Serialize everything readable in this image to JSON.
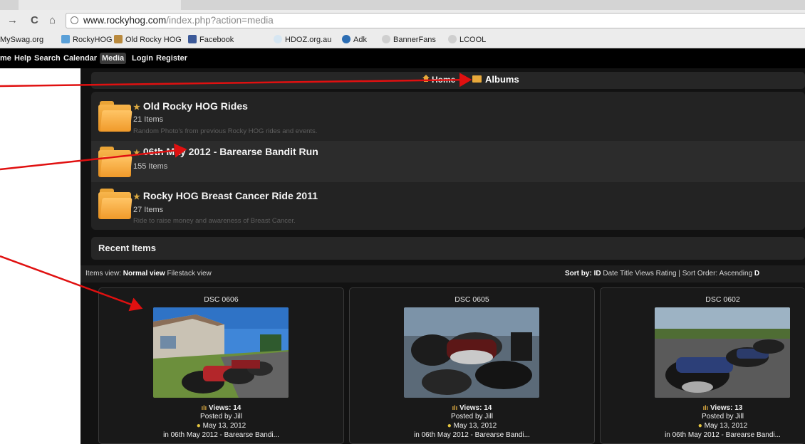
{
  "browser": {
    "url_host": "www.rockyhog.com",
    "url_path": "/index.php?action=media",
    "bookmarks": [
      "MySwag.org",
      "RockyHOG",
      "Old Rocky HOG",
      "Facebook",
      "HDOZ.org.au",
      "Adk",
      "BannerFans",
      "LCOOL"
    ]
  },
  "nav": {
    "items": [
      "me",
      "Help",
      "Search",
      "Calendar",
      "Media",
      "Login",
      "Register"
    ],
    "active": "Media"
  },
  "breadcrumb": {
    "home": "Home",
    "albums": "Albums"
  },
  "albums": [
    {
      "title": "Old Rocky HOG Rides",
      "count": "21 Items",
      "description": "Random Photo's from previous Rocky HOG rides and events."
    },
    {
      "title": "06th May 2012 - Barearse Bandit Run",
      "count": "155 Items",
      "description": ""
    },
    {
      "title": "Rocky HOG Breast Cancer Ride 2011",
      "count": "27 Items",
      "description": "Ride to raise money and awareness of Breast Cancer."
    }
  ],
  "recent": {
    "title": "Recent Items",
    "items_view_label": "Items view:",
    "items_view_options": [
      "Normal view",
      "Filestack view"
    ],
    "sort_by_label": "Sort by:",
    "sort_options": [
      "ID",
      "Date",
      "Title",
      "Views",
      "Rating"
    ],
    "sort_order_label": "| Sort Order:",
    "sort_order_value": "Ascending",
    "sort_order_trail": "D"
  },
  "items": [
    {
      "title": "DSC 0606",
      "views": "Views: 14",
      "posted_by": "Posted by Jill",
      "date": "May 13, 2012",
      "album": "in 06th May 2012 - Barearse Bandi..."
    },
    {
      "title": "DSC 0605",
      "views": "Views: 14",
      "posted_by": "Posted by Jill",
      "date": "May 13, 2012",
      "album": "in 06th May 2012 - Barearse Bandi..."
    },
    {
      "title": "DSC 0602",
      "views": "Views: 13",
      "posted_by": "Posted by Jill",
      "date": "May 13, 2012",
      "album": "in 06th May 2012 - Barearse Bandi..."
    }
  ],
  "colors": {
    "annotation_arrow": "#e01010",
    "folder": "#f2a232",
    "page_bg": "#121212"
  }
}
